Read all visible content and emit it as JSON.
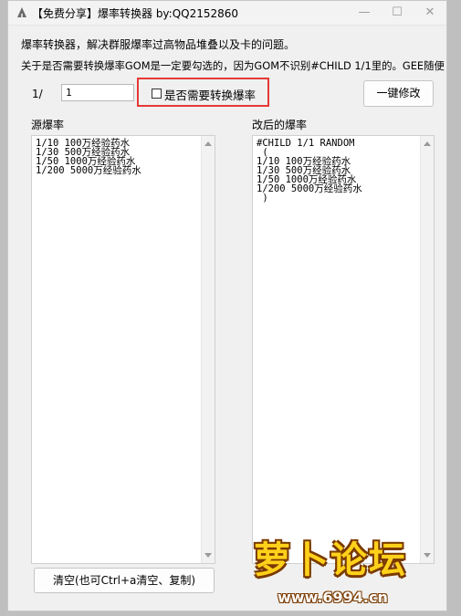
{
  "window": {
    "title": "【免费分享】爆率转换器   by:QQ2152860",
    "controls": {
      "minimize": "—",
      "maximize": "☐",
      "close": "✕"
    }
  },
  "intro": {
    "line1": "爆率转换器，解决群服爆率过高物品堆叠以及卡的问题。",
    "line2": "关于是否需要转换爆率GOM是一定要勾选的，因为GOM不识别#CHILD 1/1里的。GEE随便"
  },
  "controls": {
    "prefix_label": "1/",
    "rate_value": "1",
    "convert_checkbox_label": "是否需要转换爆率",
    "convert_checked": false,
    "apply_button": "一键修改",
    "clear_button": "清空(也可Ctrl+a清空、复制)"
  },
  "source": {
    "label": "源爆率",
    "lines": [
      "1/10 100万经验药水",
      "1/30 500万经验药水",
      "1/50 1000万经验药水",
      "1/200 5000万经验药水"
    ]
  },
  "result": {
    "label": "改后的爆率",
    "lines": [
      "#CHILD 1/1 RANDOM",
      " (",
      "1/10 100万经验药水",
      "1/30 500万经验药水",
      "1/50 1000万经验药水",
      "1/200 5000万经验药水",
      " )"
    ]
  },
  "watermark": {
    "brand": "萝卜论坛",
    "url": "www.6994.cn"
  }
}
